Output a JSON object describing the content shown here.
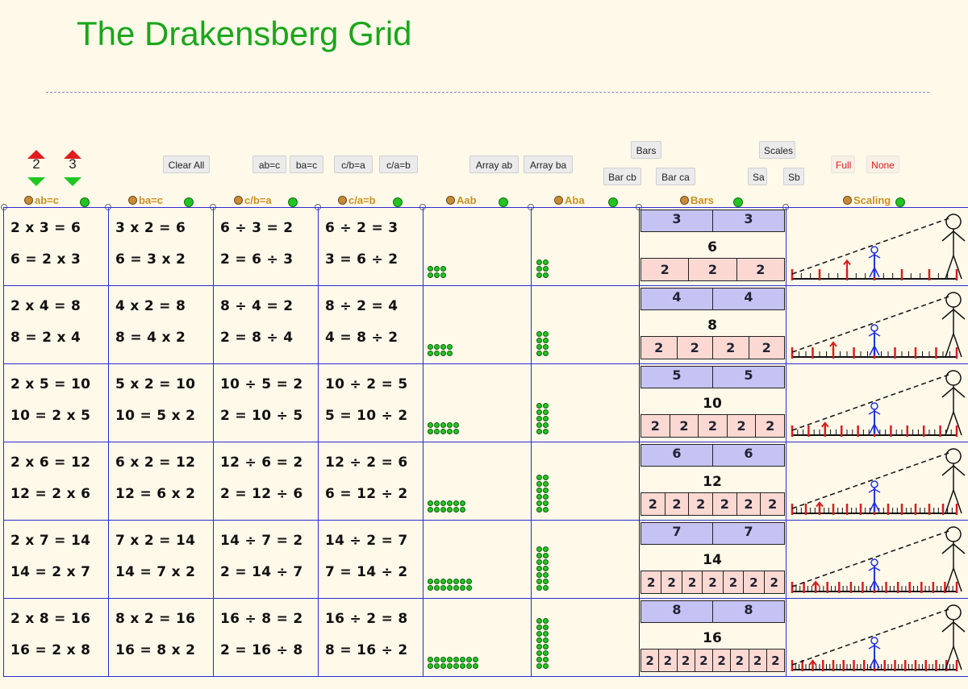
{
  "title": "The Drakensberg Grid",
  "controls": {
    "stepper_a": "2",
    "stepper_b": "3",
    "clear_all": "Clear All",
    "ab_c": "ab=c",
    "ba_c": "ba=c",
    "c_b_a": "c/b=a",
    "c_a_b": "c/a=b",
    "array_ab": "Array ab",
    "array_ba": "Array ba",
    "bars": "Bars",
    "bar_cb": "Bar cb",
    "bar_ca": "Bar ca",
    "scales": "Scales",
    "sa": "Sa",
    "sb": "Sb",
    "full": "Full",
    "none": "None"
  },
  "column_headers": [
    "ab=c",
    "ba=c",
    "c/b=a",
    "c/a=b",
    "Aab",
    "Aba",
    "Bars",
    "Scaling"
  ],
  "rows": [
    {
      "a": 2,
      "b": 3,
      "c": 6,
      "eq": [
        "2 x 3 = 6",
        "6 = 2 x 3",
        "3 x 2 = 6",
        "6 = 3 x 2",
        "6 ÷ 3 = 2",
        "2 = 6 ÷ 3",
        "6 ÷ 2 = 3",
        "3 = 6 ÷ 2"
      ],
      "top_bars": [
        "3",
        "3"
      ],
      "product": "6",
      "bottom_bars": [
        "2",
        "2",
        "2"
      ]
    },
    {
      "a": 2,
      "b": 4,
      "c": 8,
      "eq": [
        "2 x 4 = 8",
        "8 = 2 x 4",
        "4 x 2 = 8",
        "8 = 4 x 2",
        "8 ÷ 4 = 2",
        "2 = 8 ÷ 4",
        "8 ÷ 2 = 4",
        "4 = 8 ÷ 2"
      ],
      "top_bars": [
        "4",
        "4"
      ],
      "product": "8",
      "bottom_bars": [
        "2",
        "2",
        "2",
        "2"
      ]
    },
    {
      "a": 2,
      "b": 5,
      "c": 10,
      "eq": [
        "2 x 5 = 10",
        "10 = 2 x 5",
        "5 x 2 = 10",
        "10 = 5 x 2",
        "10 ÷ 5 = 2",
        "2 = 10 ÷ 5",
        "10 ÷ 2 = 5",
        "5 = 10 ÷ 2"
      ],
      "top_bars": [
        "5",
        "5"
      ],
      "product": "10",
      "bottom_bars": [
        "2",
        "2",
        "2",
        "2",
        "2"
      ]
    },
    {
      "a": 2,
      "b": 6,
      "c": 12,
      "eq": [
        "2 x 6 = 12",
        "12 = 2 x 6",
        "6 x 2 = 12",
        "12 = 6 x 2",
        "12 ÷ 6 = 2",
        "2 = 12 ÷ 6",
        "12 ÷ 2 = 6",
        "6 = 12 ÷ 2"
      ],
      "top_bars": [
        "6",
        "6"
      ],
      "product": "12",
      "bottom_bars": [
        "2",
        "2",
        "2",
        "2",
        "2",
        "2"
      ]
    },
    {
      "a": 2,
      "b": 7,
      "c": 14,
      "eq": [
        "2 x 7 = 14",
        "14 = 2 x 7",
        "7 x 2 = 14",
        "14 = 7 x 2",
        "14 ÷ 7 = 2",
        "2 = 14 ÷ 7",
        "14 ÷ 2 = 7",
        "7 = 14 ÷ 2"
      ],
      "top_bars": [
        "7",
        "7"
      ],
      "product": "14",
      "bottom_bars": [
        "2",
        "2",
        "2",
        "2",
        "2",
        "2",
        "2"
      ]
    },
    {
      "a": 2,
      "b": 8,
      "c": 16,
      "eq": [
        "2 x 8 = 16",
        "16 = 2 x 8",
        "8 x 2 = 16",
        "16 = 8 x 2",
        "16 ÷ 8 = 2",
        "2 = 16 ÷ 8",
        "16 ÷ 2 = 8",
        "8 = 16 ÷ 2"
      ],
      "top_bars": [
        "8",
        "8"
      ],
      "product": "16",
      "bottom_bars": [
        "2",
        "2",
        "2",
        "2",
        "2",
        "2",
        "2",
        "2"
      ]
    }
  ]
}
